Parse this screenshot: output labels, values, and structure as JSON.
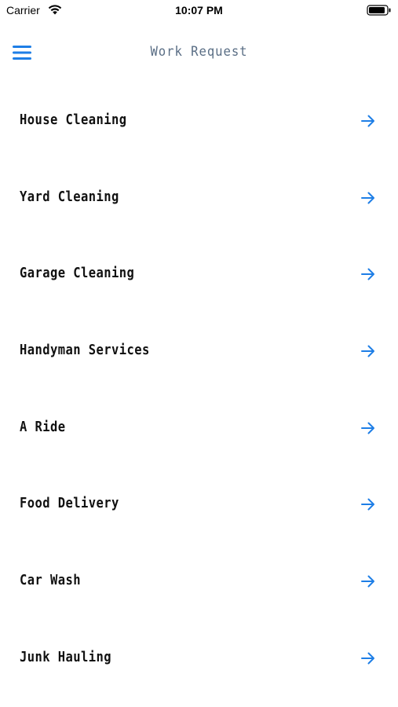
{
  "status_bar": {
    "carrier": "Carrier",
    "time": "10:07 PM",
    "icons": [
      "wifi-icon",
      "battery-icon"
    ]
  },
  "header": {
    "title": "Work Request",
    "menu_icon": "hamburger-menu-icon"
  },
  "services": [
    {
      "label": "House Cleaning"
    },
    {
      "label": "Yard Cleaning"
    },
    {
      "label": "Garage Cleaning"
    },
    {
      "label": "Handyman Services"
    },
    {
      "label": "A Ride"
    },
    {
      "label": "Food Delivery"
    },
    {
      "label": "Car Wash"
    },
    {
      "label": "Junk Hauling"
    }
  ],
  "colors": {
    "accent": "#1e7ee6",
    "title": "#5a6e85",
    "text": "#111111",
    "background": "#ffffff"
  }
}
